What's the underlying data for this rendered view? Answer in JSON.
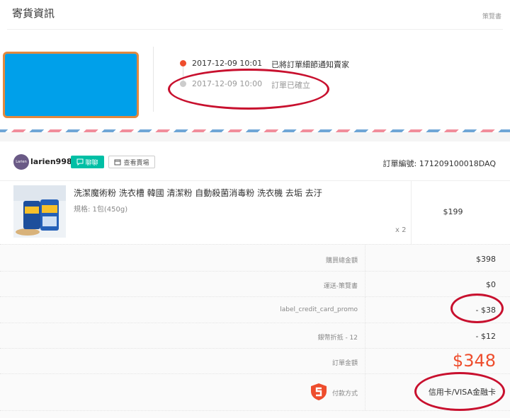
{
  "shipping": {
    "title": "寄貨資訊",
    "right_label": "策覽書",
    "timeline": [
      {
        "time": "2017-12-09 10:01",
        "text": "已將訂單細節通知賣家"
      },
      {
        "time": "2017-12-09 10:00",
        "text": "訂單已確立"
      }
    ]
  },
  "order": {
    "avatar_text": "Larien",
    "shop_name": "larien9988",
    "chat_label": "聊聊",
    "shop_label": "查看賣場",
    "order_no_label": "訂單編號:",
    "order_no": "171209100018DAQ",
    "product": {
      "name": "洗潔魔術粉 洗衣槽 韓國 清潔粉 自動殺菌消毒粉 洗衣機 去垢 去汙",
      "variation": "規格: 1包(450g)",
      "qty": "x 2",
      "price": "$199"
    }
  },
  "summary": {
    "rows": [
      {
        "label": "購買總金額",
        "value": "$398"
      },
      {
        "label": "運送-策覽書",
        "value": "$0"
      },
      {
        "label": "label_credit_card_promo",
        "value": "- $38"
      },
      {
        "label": "銀幣折抵 - 12",
        "value": "- $12"
      },
      {
        "label": "訂單金額",
        "value": "$348"
      },
      {
        "label": "付款方式",
        "value": "信用卡/VISA金融卡"
      }
    ]
  },
  "colors": {
    "accent": "#ee4d2d",
    "chat": "#00bfa5",
    "annotation": "#c8102e",
    "blue_box": "#00a0ea",
    "blue_box_border": "#e3893e"
  },
  "icons": [
    "chat-bubble-icon",
    "shop-icon",
    "shield-s-icon"
  ]
}
